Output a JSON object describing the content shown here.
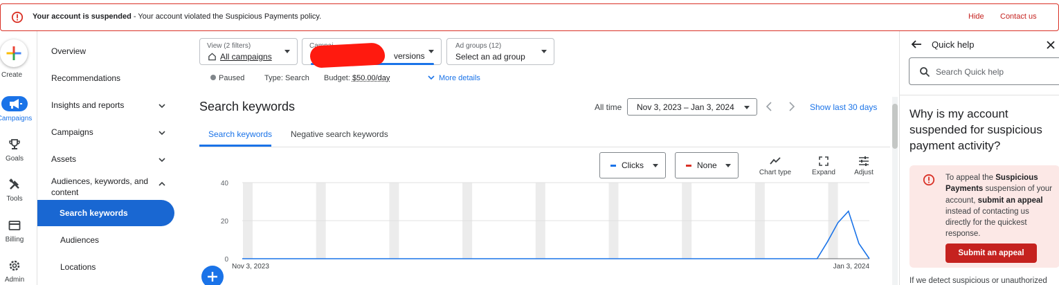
{
  "banner": {
    "title": "Your account is suspended",
    "separator": " - ",
    "message": "Your account violated the Suspicious Payments policy.",
    "hide_label": "Hide",
    "contact_label": "Contact us"
  },
  "rail": {
    "items": [
      {
        "label": "Create",
        "icon": "plus-icon"
      },
      {
        "label": "Campaigns",
        "icon": "megaphone-icon"
      },
      {
        "label": "Goals",
        "icon": "trophy-icon"
      },
      {
        "label": "Tools",
        "icon": "tools-icon"
      },
      {
        "label": "Billing",
        "icon": "credit-card-icon"
      },
      {
        "label": "Admin",
        "icon": "gear-icon"
      }
    ]
  },
  "nav": {
    "items": [
      "Overview",
      "Recommendations",
      "Insights and reports",
      "Campaigns",
      "Assets"
    ],
    "audiences_label_1": "Audiences, keywords, and",
    "audiences_label_2": "content",
    "sub_items": [
      "Search keywords",
      "Audiences",
      "Locations"
    ]
  },
  "filters": {
    "view_small": "View (2 filters)",
    "view_value": "All campaigns",
    "campaign_small": "Campai",
    "campaign_value": "versions",
    "adgroup_small": "Ad groups (12)",
    "adgroup_value": "Select an ad group"
  },
  "status": {
    "paused": "Paused",
    "type": "Type: Search",
    "budget_label": "Budget:",
    "budget_value": "$50.00/day",
    "more_details": "More details"
  },
  "section": {
    "title": "Search keywords",
    "all_time": "All time",
    "date_range": "Nov 3, 2023 – Jan 3, 2024",
    "show_last": "Show last 30 days",
    "tabs": [
      "Search keywords",
      "Negative search keywords"
    ],
    "metric1": "Clicks",
    "metric2": "None",
    "chart_type": "Chart type",
    "expand": "Expand",
    "adjust": "Adjust"
  },
  "colors": {
    "accent": "#1a73e8",
    "error": "#c5221f",
    "metric1": "#1a73e8",
    "metric2": "#d93025"
  },
  "chart_data": {
    "type": "line",
    "series": [
      {
        "name": "Clicks",
        "values": [
          0,
          0,
          0,
          0,
          0,
          0,
          0,
          0,
          0,
          0,
          0,
          0,
          0,
          0,
          0,
          0,
          0,
          0,
          0,
          0,
          0,
          0,
          0,
          0,
          0,
          0,
          0,
          0,
          0,
          0,
          0,
          0,
          0,
          0,
          0,
          0,
          0,
          0,
          0,
          0,
          0,
          0,
          0,
          0,
          0,
          0,
          0,
          0,
          0,
          0,
          0,
          0,
          0,
          0,
          0,
          0,
          9,
          19,
          25,
          8,
          0
        ]
      }
    ],
    "x_start_label": "Nov 3, 2023",
    "x_end_label": "Jan 3, 2024",
    "yticks": [
      0,
      20,
      40
    ],
    "ylim": [
      0,
      40
    ],
    "grid": true,
    "legend": "none"
  },
  "quick_help": {
    "title": "Quick help",
    "search_placeholder": "Search Quick help",
    "question": "Why is my account suspended for suspicious payment activity?",
    "card": {
      "t1": "To appeal the ",
      "b1": "Suspicious Payments",
      "t2": " suspension of your account, ",
      "b2": "submit an appeal",
      "t3": " instead of contacting us directly for the quickest response."
    },
    "appeal_button": "Submit an appeal",
    "footer_text": "If we detect suspicious or unauthorized"
  }
}
